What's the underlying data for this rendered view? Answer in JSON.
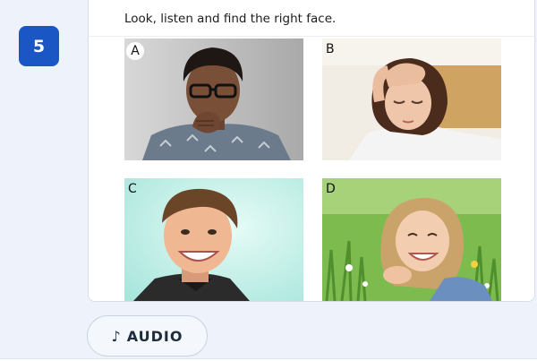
{
  "exercise": {
    "number": "5",
    "instruction": "Look, listen and find the right face."
  },
  "photos": [
    {
      "letter": "A",
      "icon": "pensive-man-photo"
    },
    {
      "letter": "B",
      "icon": "tired-woman-photo"
    },
    {
      "letter": "C",
      "icon": "smiling-boy-photo"
    },
    {
      "letter": "D",
      "icon": "smiling-girl-in-grass-photo"
    }
  ],
  "audio": {
    "icon": "music-note-icon",
    "glyph": "♪",
    "label": "AUDIO"
  },
  "colors": {
    "accent": "#1a56c4",
    "rail": "#eef3fb",
    "border": "#d7dee8"
  }
}
